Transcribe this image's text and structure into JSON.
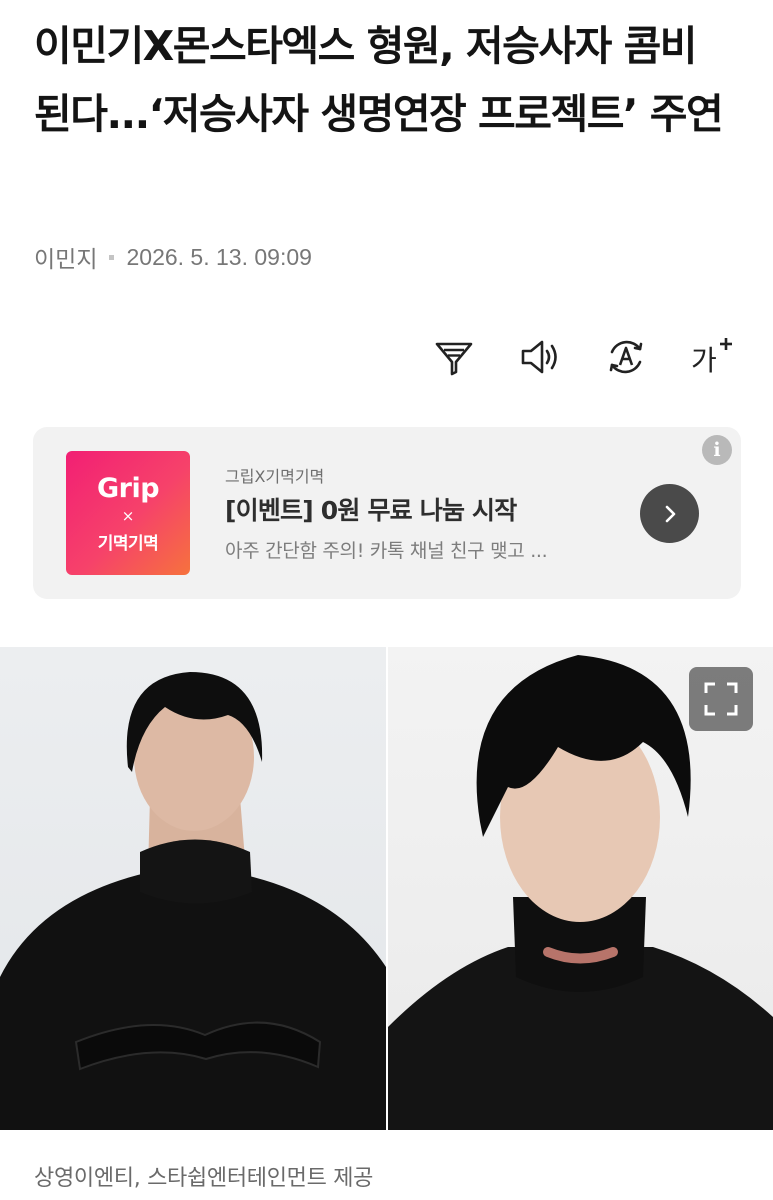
{
  "article": {
    "headline": "이민기X몬스타엑스 형원, 저승사자 콤비 된다...‘저승사자 생명연장 프로젝트’ 주연",
    "author": "이민지",
    "datetime": "2026. 5. 13. 09:09"
  },
  "toolbar": {
    "icons": [
      "filter-icon",
      "speaker-icon",
      "translate-icon",
      "font-size-icon"
    ],
    "font_size_glyph": "가"
  },
  "ad": {
    "logo_top": "Grip",
    "logo_x": "×",
    "logo_bottom": "기멱기멱",
    "sponsor": "그립X기멱기멱",
    "title": "[이벤트] 0원 무료 나눔 시작",
    "description": "아주 간단함 주의! 카톡 채널 친구 맺고 ...",
    "info_glyph": "i",
    "colors": {
      "logo_start": "#f21f74",
      "logo_end": "#f6723d",
      "arrow_bg": "#4a4a4a"
    }
  },
  "photo": {
    "caption": "상영이엔티, 스타쉽엔터테인먼트 제공"
  }
}
